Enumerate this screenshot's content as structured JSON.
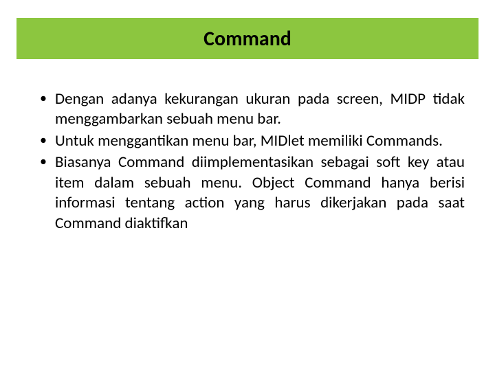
{
  "title": "Command",
  "bullets": [
    "Dengan adanya kekurangan ukuran pada screen, MIDP tidak menggambarkan sebuah menu  bar.",
    "Untuk  menggantikan  menu  bar,  MIDlet  memiliki Commands.",
    "Biasanya Command diimplementasikan sebagai  soft key atau  item dalam sebuah menu.  Object  Command  hanya  berisi  informasi  tentang  action  yang  harus  dikerjakan  pada  saat  Command  diaktifkan"
  ]
}
